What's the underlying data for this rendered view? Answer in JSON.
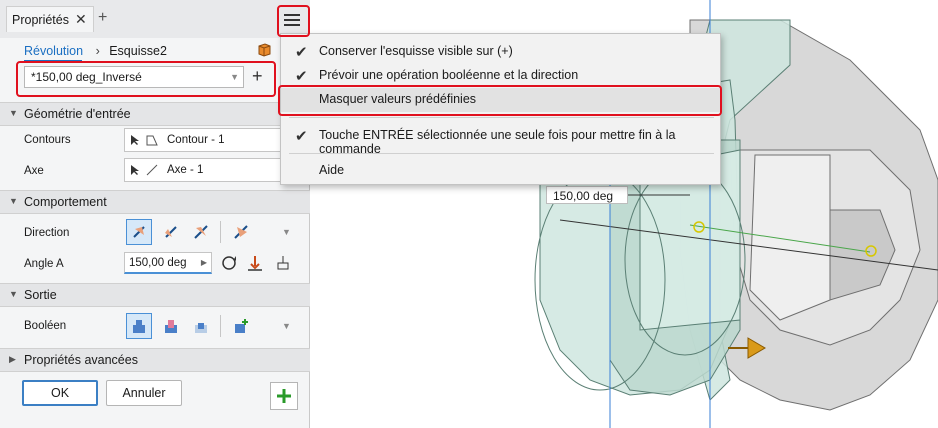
{
  "panel": {
    "tab_title": "Propriétés",
    "breadcrumb": {
      "feature": "Révolution",
      "sketch": "Esquisse2"
    },
    "preset_value": "*150,00 deg_Inversé",
    "sections": {
      "input_geometry": "Géométrie d'entrée",
      "behavior": "Comportement",
      "output": "Sortie",
      "advanced": "Propriétés avancées"
    },
    "rows": {
      "contours_label": "Contours",
      "contours_value": "Contour - 1",
      "axis_label": "Axe",
      "axis_value": "Axe - 1",
      "direction_label": "Direction",
      "angle_label": "Angle A",
      "angle_value": "150,00 deg",
      "boolean_label": "Booléen"
    },
    "buttons": {
      "ok": "OK",
      "cancel": "Annuler"
    }
  },
  "menu": {
    "items": [
      {
        "label": "Conserver l'esquisse visible sur (+)",
        "checked": true
      },
      {
        "label": "Prévoir une opération booléenne et la direction",
        "checked": true
      },
      {
        "label": "Masquer valeurs prédéfinies",
        "checked": false,
        "hovered": true
      },
      {
        "label": "Touche ENTRÉE sélectionnée une seule fois pour mettre fin à la commande",
        "checked": true
      },
      {
        "label": "Aide",
        "checked": false
      }
    ]
  },
  "viewport": {
    "dimension_label": "150,00 deg"
  },
  "colors": {
    "accent": "#1b6fc2",
    "highlight": "#e0101e",
    "preview_fill": "#cfe6df",
    "active_button": "#d6e8f8"
  },
  "icons": [
    "close-icon",
    "plus-icon",
    "hamburger-menu-icon",
    "cube-icon",
    "checkmark-icon",
    "cursor-icon",
    "revolve-direction-icon",
    "join-icon",
    "cut-icon",
    "intersect-icon",
    "new-solid-icon"
  ]
}
